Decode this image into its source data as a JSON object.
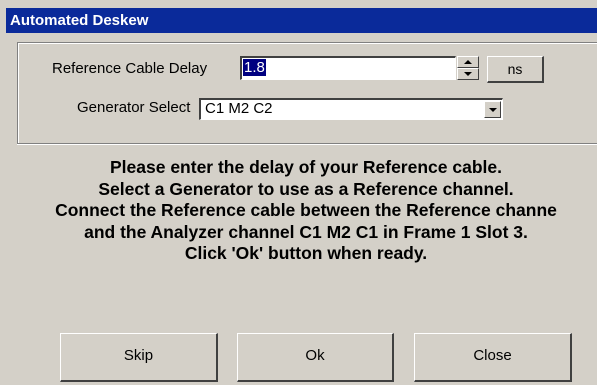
{
  "window": {
    "title": "Automated Deskew"
  },
  "reference": {
    "label": "Reference Cable Delay",
    "value": "1.8",
    "unit_button": "ns"
  },
  "generator": {
    "label": "Generator Select",
    "selected": "C1 M2 C2"
  },
  "message": {
    "lines": [
      "Please enter the delay of your Reference cable.",
      "Select a Generator to use as a Reference channel.",
      "Connect the Reference cable between the Reference channe",
      "and the Analyzer channel  C1 M2 C1 in Frame 1 Slot 3.",
      "Click 'Ok' button when ready."
    ]
  },
  "buttons": {
    "skip": "Skip",
    "ok": "Ok",
    "close": "Close"
  }
}
